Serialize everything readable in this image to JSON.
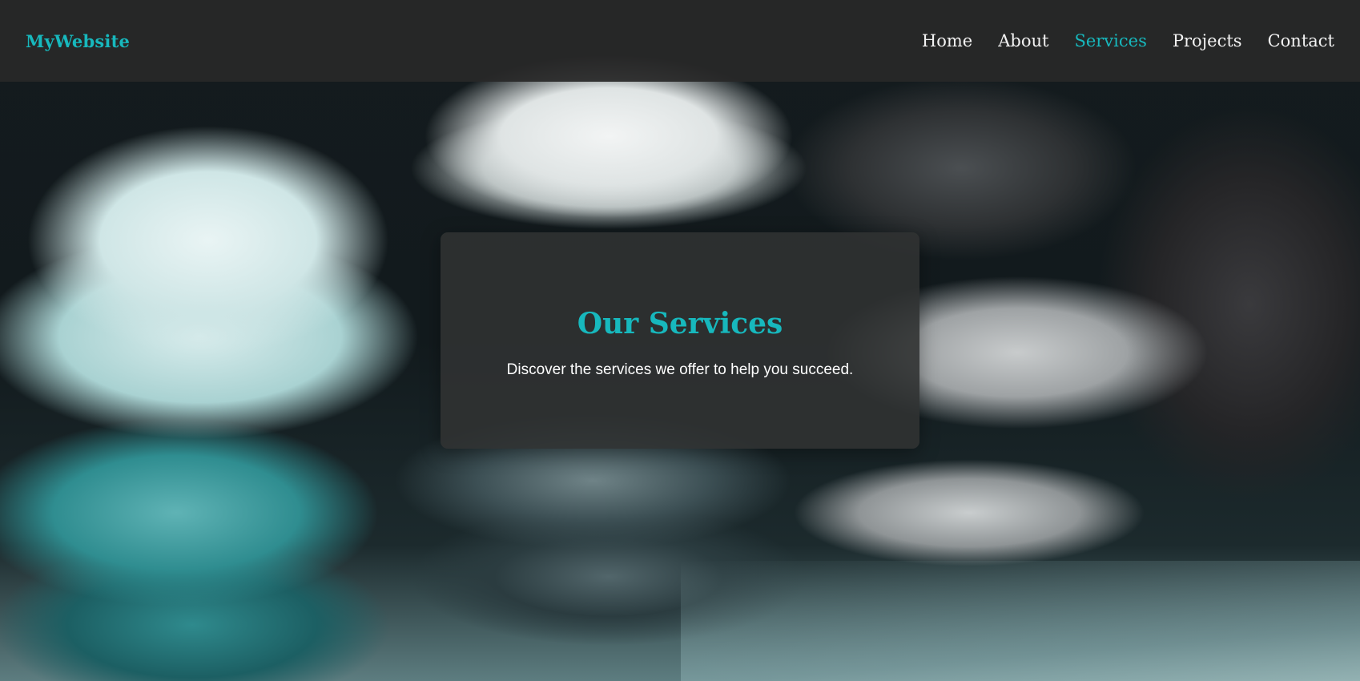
{
  "header": {
    "logo": "MyWebsite",
    "nav": [
      {
        "label": "Home"
      },
      {
        "label": "About"
      },
      {
        "label": "Services"
      },
      {
        "label": "Projects"
      },
      {
        "label": "Contact"
      }
    ],
    "active_nav": "Services"
  },
  "hero": {
    "title": "Our Services",
    "subtitle": "Discover the services we offer to help you succeed."
  },
  "colors": {
    "accent": "#17b8bd",
    "header_bg": "#282828",
    "card_bg": "#303232",
    "text": "#ffffff"
  }
}
